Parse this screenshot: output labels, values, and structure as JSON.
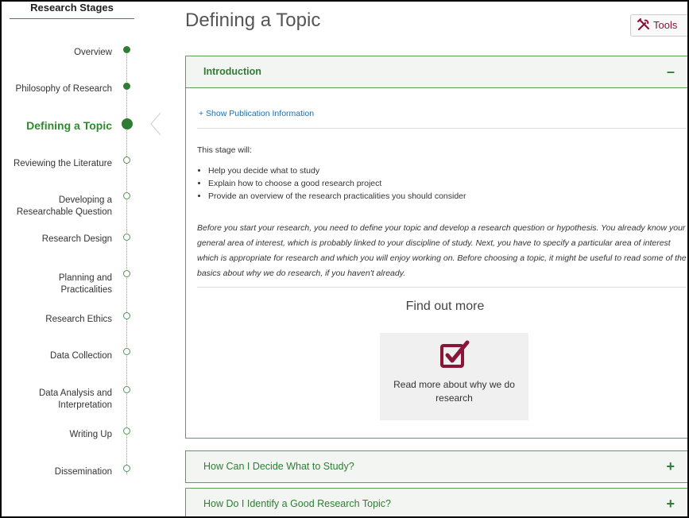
{
  "sidebar": {
    "title": "Research Stages",
    "stages": [
      {
        "label": "Overview",
        "state": "completed"
      },
      {
        "label": "Philosophy of Research",
        "state": "completed"
      },
      {
        "label": "Defining a Topic",
        "state": "active"
      },
      {
        "label": "Reviewing the Literature",
        "state": "upcoming"
      },
      {
        "label": "Developing a Researchable Question",
        "line1": "Developing a",
        "line2": "Researchable Question",
        "state": "upcoming"
      },
      {
        "label": "Research Design",
        "state": "upcoming"
      },
      {
        "label": "Planning and Practicalities",
        "line1": "Planning and",
        "line2": "Practicalities",
        "state": "upcoming"
      },
      {
        "label": "Research Ethics",
        "state": "upcoming"
      },
      {
        "label": "Data Collection",
        "state": "upcoming"
      },
      {
        "label": "Data Analysis and Interpretation",
        "line1": "Data Analysis and",
        "line2": "Interpretation",
        "state": "upcoming"
      },
      {
        "label": "Writing Up",
        "state": "upcoming"
      },
      {
        "label": "Dissemination",
        "state": "upcoming"
      }
    ],
    "colors": {
      "accent": "#2e7d32",
      "active_text": "#2e8b2e"
    }
  },
  "main": {
    "title": "Defining a Topic",
    "tools_label": "Tools",
    "tools_icon": "tools-icon",
    "intro": {
      "heading": "Introduction",
      "toggle": "–",
      "show_publication": "+ Show Publication Information",
      "stage_will": "This stage will:",
      "bullets": [
        "Help you decide what to study",
        "Explain how to choose a good research project",
        "Provide an overview of the research practicalities you should consider"
      ],
      "paragraph": "Before you start your research, you need to define your topic and develop a research question or hypothesis. You already know your general area of interest, which is probably linked to your discipline of study. Next, you have to specify a particular area of interest which is appropriate for research and which you will enjoy working on. Before choosing a topic, it might be useful to read some of the basics about why we do research, if you haven't already.",
      "find_out_more": "Find out more",
      "card_icon": "checkbox-checked-icon",
      "card_text": "Read more about why we do research"
    },
    "sections": [
      {
        "heading": "How Can I Decide What to Study?",
        "toggle": "+"
      },
      {
        "heading": "How Do I Identify a Good Research Topic?",
        "toggle": "+"
      }
    ],
    "colors": {
      "brand": "#8a1538",
      "link": "#1a6fb0",
      "panel_border": "#5aa05a"
    }
  }
}
